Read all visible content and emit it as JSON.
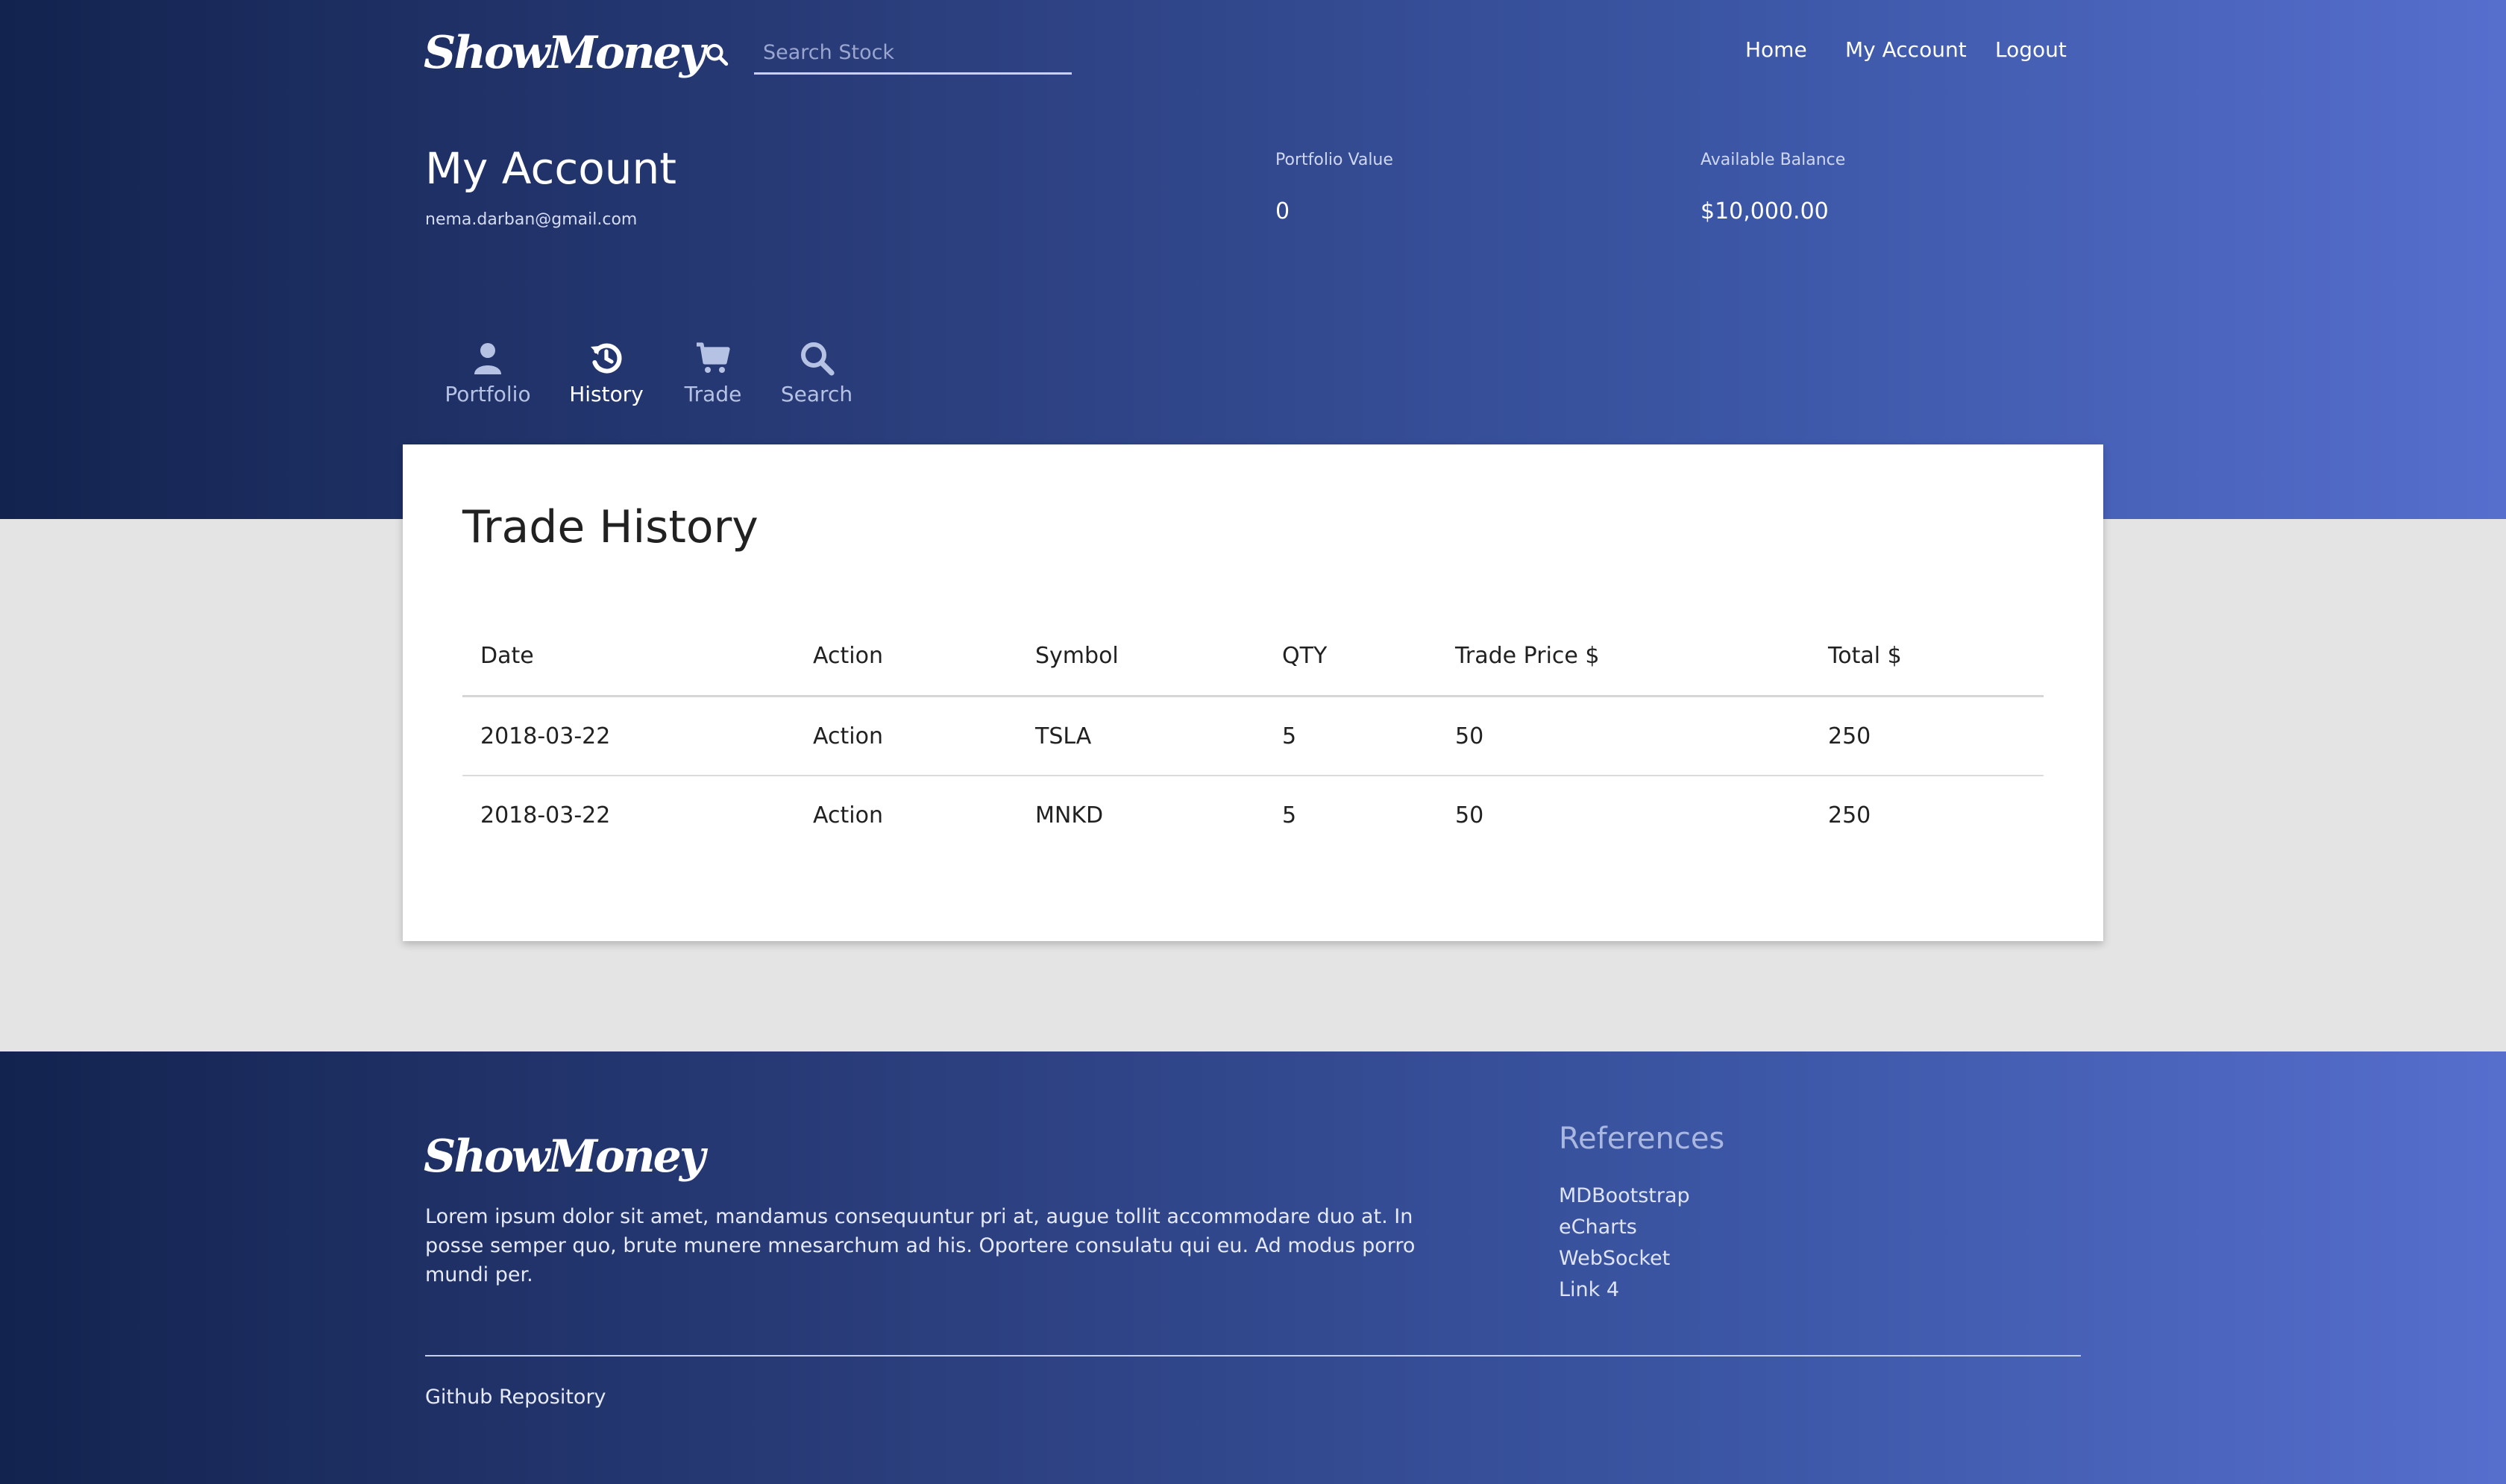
{
  "brand": {
    "logo": "ShowMoney"
  },
  "search": {
    "placeholder": "Search Stock",
    "value": ""
  },
  "nav": [
    {
      "label": "Home"
    },
    {
      "label": "My Account"
    },
    {
      "label": "Logout"
    }
  ],
  "account": {
    "title": "My Account",
    "email": "nema.darban@gmail.com",
    "portfolio_value_label": "Portfolio Value",
    "portfolio_value": "0",
    "available_balance_label": "Available Balance",
    "available_balance": "$10,000.00"
  },
  "tabs": [
    {
      "label": "Portfolio",
      "icon": "user-icon",
      "active": false
    },
    {
      "label": "History",
      "icon": "history-icon",
      "active": true
    },
    {
      "label": "Trade",
      "icon": "cart-icon",
      "active": false
    },
    {
      "label": "Search",
      "icon": "search-icon",
      "active": false
    }
  ],
  "history": {
    "title": "Trade History",
    "columns": [
      "Date",
      "Action",
      "Symbol",
      "QTY",
      "Trade Price $",
      "Total $"
    ],
    "rows": [
      [
        "2018-03-22",
        "Action",
        "TSLA",
        "5",
        "50",
        "250"
      ],
      [
        "2018-03-22",
        "Action",
        "MNKD",
        "5",
        "50",
        "250"
      ]
    ]
  },
  "footer": {
    "logo": "ShowMoney",
    "description": "Lorem ipsum dolor sit amet, mandamus consequuntur pri at, augue tollit accommodare duo at. In posse semper quo, brute munere mnesarchum ad his. Oportere consulatu qui eu. Ad modus porro mundi per.",
    "references_title": "References",
    "references": [
      "MDBootstrap",
      "eCharts",
      "WebSocket",
      "Link 4"
    ],
    "github": "Github Repository"
  },
  "colors": {
    "gradient_start": "#13234f",
    "gradient_end": "#566ecd",
    "page_bg": "#e4e4e4",
    "card_bg": "#ffffff"
  }
}
